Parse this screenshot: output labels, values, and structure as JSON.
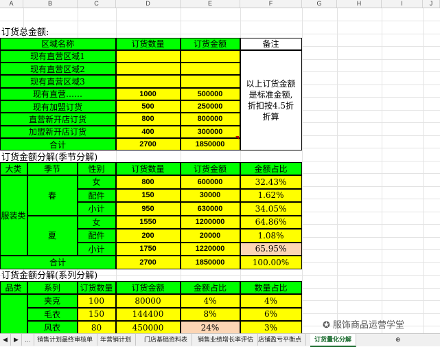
{
  "columns": [
    "A",
    "B",
    "C",
    "D",
    "E",
    "F",
    "G",
    "H",
    "I",
    "J"
  ],
  "section1": {
    "title": "订货总金额:",
    "headers": [
      "区域名称",
      "订货数量",
      "订货金额",
      "备注"
    ],
    "rows": [
      {
        "name": "现有直营区域1",
        "qty": "",
        "amount": ""
      },
      {
        "name": "现有直营区域2",
        "qty": "",
        "amount": ""
      },
      {
        "name": "现有直营区域3",
        "qty": "",
        "amount": ""
      },
      {
        "name": "现有直营……",
        "qty": "1000",
        "amount": "500000"
      },
      {
        "name": "现有加盟订货",
        "qty": "500",
        "amount": "250000"
      },
      {
        "name": "直营新开店订货",
        "qty": "800",
        "amount": "800000"
      },
      {
        "name": "加盟新开店订货",
        "qty": "400",
        "amount": "300000"
      },
      {
        "name": "合计",
        "qty": "2700",
        "amount": "1850000"
      }
    ],
    "note": "以上订货金额是标准金额,折扣按4.5折折算"
  },
  "section2": {
    "title": "订货金额分解(季节分解)",
    "headers": [
      "大类",
      "季节",
      "性别",
      "订货数量",
      "订货金额",
      "金额占比"
    ],
    "category": "服装类",
    "seasons": [
      "春",
      "夏"
    ],
    "rows": [
      {
        "gender": "女",
        "qty": "800",
        "amount": "600000",
        "ratio": "32.43%"
      },
      {
        "gender": "配件",
        "qty": "150",
        "amount": "30000",
        "ratio": "1.62%"
      },
      {
        "gender": "小计",
        "qty": "950",
        "amount": "630000",
        "ratio": "34.05%"
      },
      {
        "gender": "女",
        "qty": "1550",
        "amount": "1200000",
        "ratio": "64.86%"
      },
      {
        "gender": "配件",
        "qty": "200",
        "amount": "20000",
        "ratio": "1.08%"
      },
      {
        "gender": "小计",
        "qty": "1750",
        "amount": "1220000",
        "ratio": "65.95%"
      }
    ],
    "total": {
      "label": "合计",
      "qty": "2700",
      "amount": "1850000",
      "ratio": "100.00%"
    }
  },
  "section3": {
    "title": "订货金额分解(系列分解)",
    "headers": [
      "品类",
      "系列",
      "订货数量",
      "订货金额",
      "金额占比",
      "数量占比"
    ],
    "rows": [
      {
        "series": "夹克",
        "qty": "100",
        "amount": "80000",
        "amt_ratio": "4%",
        "qty_ratio": "4%"
      },
      {
        "series": "毛衣",
        "qty": "150",
        "amount": "144400",
        "amt_ratio": "8%",
        "qty_ratio": "6%"
      },
      {
        "series": "风衣",
        "qty": "80",
        "amount": "450000",
        "amt_ratio": "24%",
        "qty_ratio": "3%"
      }
    ]
  },
  "sheet_tabs": [
    "销售计划最终审核单",
    "年营销计划",
    "门店基础资料表",
    "销售业绩增长率评估",
    "店铺盈亏平衡点",
    "订货量化分解"
  ],
  "active_tab": "订货量化分解",
  "watermark": "服饰商品运营学堂",
  "colors": {
    "green": "#00ff00",
    "yellow": "#ffff00",
    "peach": "#fcd5b4",
    "tab_active": "#1a6b2e"
  }
}
